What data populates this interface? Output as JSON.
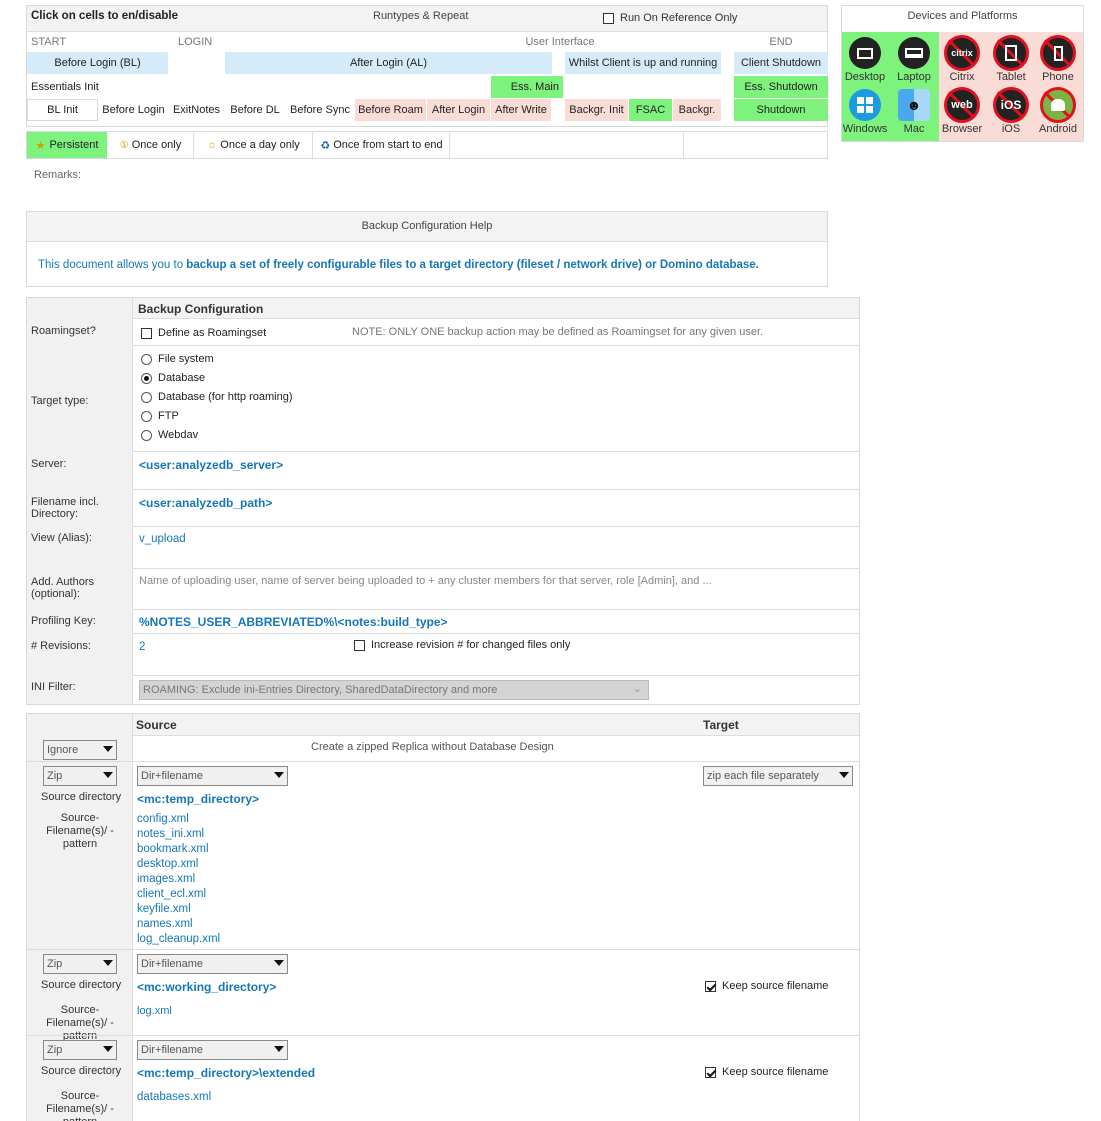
{
  "runtypes": {
    "click_label": "Click on cells to en/disable",
    "title": "Runtypes & Repeat",
    "run_ref_label": "Run On Reference Only",
    "phase_headers": {
      "start": "START",
      "login": "LOGIN",
      "ui": "User Interface",
      "end": "END"
    },
    "row1": {
      "bl": "Before Login (BL)",
      "al": "After Login (AL)",
      "whilst": "Whilst Client is up and running",
      "client_shutdown": "Client Shutdown"
    },
    "row2": {
      "essentials": "Essentials Init",
      "ess_main": "Ess. Main",
      "ess_shutdown": "Ess. Shutdown"
    },
    "row3": {
      "bl_init": "BL Init",
      "before_login": "Before Login",
      "exitnotes": "ExitNotes",
      "before_dl": "Before DL",
      "before_sync": "Before Sync",
      "before_roam": "Before Roam",
      "after_login": "After Login",
      "after_write": "After Write",
      "backgr_init": "Backgr. Init",
      "fsac": "FSAC",
      "backgr": "Backgr.",
      "shutdown": "Shutdown"
    },
    "repeat": {
      "persistent": "Persistent",
      "once_only": "Once only",
      "once_day": "Once a day only",
      "once_start_end": "Once from start to end"
    },
    "remarks_label": "Remarks:"
  },
  "devices": {
    "title": "Devices and Platforms",
    "items": [
      {
        "label": "Desktop",
        "icon": "desktop-icon",
        "enabled": true
      },
      {
        "label": "Laptop",
        "icon": "laptop-icon",
        "enabled": true
      },
      {
        "label": "Citrix",
        "icon": "citrix-icon",
        "enabled": false,
        "text": "citrix"
      },
      {
        "label": "Tablet",
        "icon": "tablet-icon",
        "enabled": false
      },
      {
        "label": "Phone",
        "icon": "phone-icon",
        "enabled": false
      },
      {
        "label": "Windows",
        "icon": "windows-icon",
        "enabled": true
      },
      {
        "label": "Mac",
        "icon": "mac-icon",
        "enabled": true
      },
      {
        "label": "Browser",
        "icon": "browser-icon",
        "enabled": false,
        "text": "web"
      },
      {
        "label": "iOS",
        "icon": "ios-icon",
        "enabled": false,
        "text": "iOS"
      },
      {
        "label": "Android",
        "icon": "android-icon",
        "enabled": false
      }
    ]
  },
  "help": {
    "title": "Backup Configuration Help",
    "text_prefix": "This document allows you to ",
    "text_bold": "backup a set of freely configurable files to a target directory (fileset / network drive) or Domino database."
  },
  "config": {
    "section_title": "Backup Configuration",
    "roamingset_label": "Roamingset?",
    "roamingset_check": "Define as Roamingset",
    "roamingset_note": "NOTE: ONLY ONE backup action may be defined as Roamingset for any given user.",
    "target_type_label": "Target type:",
    "target_options": [
      "File system",
      "Database",
      "Database (for http roaming)",
      "FTP",
      "Webdav"
    ],
    "server_label": "Server:",
    "server_value": "<user:analyzedb_server>",
    "filename_label": "Filename incl. Directory:",
    "filename_value": "<user:analyzedb_path>",
    "view_label": "View (Alias):",
    "view_value": "v_upload",
    "authors_label": "Add. Authors (optional):",
    "authors_placeholder": "Name of uploading user, name of server being uploaded to + any cluster members for that server, role [Admin], and ...",
    "profiling_label": "Profiling Key:",
    "profiling_value": "%NOTES_USER_ABBREVIATED%\\<notes:build_type>",
    "revisions_label": "# Revisions:",
    "revisions_value": "2",
    "revisions_check": "Increase revision # for changed files only",
    "ini_label": "INI Filter:",
    "ini_value": "ROAMING: Exclude ini-Entries Directory, SharedDataDirectory and more"
  },
  "source": {
    "source_header": "Source",
    "target_header": "Target",
    "ignore_row": {
      "mode": "Ignore",
      "text": "Create a zipped Replica without Database Design"
    },
    "src_dir_label": "Source directory",
    "pattern_label": "Source- Filename(s)/ -pattern",
    "entries": [
      {
        "mode": "Zip",
        "type": "Dir+filename",
        "dir": "<mc:temp_directory>",
        "files": [
          "config.xml",
          "notes_ini.xml",
          "bookmark.xml",
          "desktop.xml",
          "images.xml",
          "client_ecl.xml",
          "keyfile.xml",
          "names.xml",
          "log_cleanup.xml"
        ],
        "target_select": "zip each file separately"
      },
      {
        "mode": "Zip",
        "type": "Dir+filename",
        "dir": "<mc:working_directory>",
        "files": [
          "log.xml"
        ],
        "target_check": "Keep source filename"
      },
      {
        "mode": "Zip",
        "type": "Dir+filename",
        "dir": "<mc:temp_directory>\\extended",
        "files": [
          "databases.xml"
        ],
        "target_check": "Keep source filename"
      }
    ]
  },
  "colors": {
    "enabled": "#7df27d",
    "disabled": "#fadcd6",
    "blue": "#d6ebf9",
    "link": "#1677b8"
  }
}
